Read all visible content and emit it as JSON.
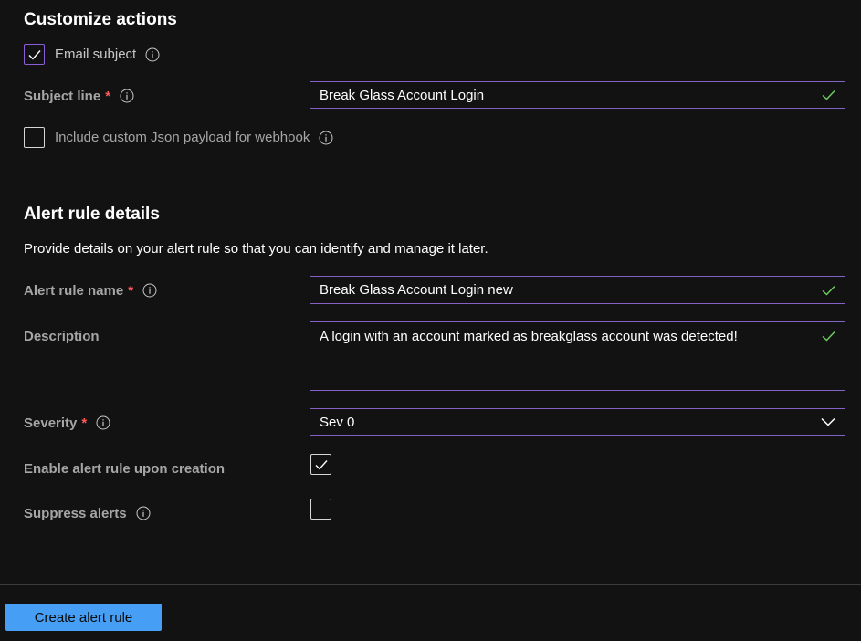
{
  "customize_actions": {
    "title": "Customize actions",
    "email_subject": {
      "label": "Email subject",
      "checked": true
    },
    "subject_line": {
      "label": "Subject line",
      "required_marker": "*",
      "value": "Break Glass Account Login"
    },
    "custom_json": {
      "label": "Include custom Json payload for webhook",
      "checked": false
    }
  },
  "alert_rule_details": {
    "title": "Alert rule details",
    "description_text": "Provide details on your alert rule so that you can identify and manage it later.",
    "alert_rule_name": {
      "label": "Alert rule name",
      "required_marker": "*",
      "value": "Break Glass Account Login new"
    },
    "description": {
      "label": "Description",
      "value": "A login with an account marked as breakglass account was detected!"
    },
    "severity": {
      "label": "Severity",
      "required_marker": "*",
      "value": "Sev 0"
    },
    "enable_rule": {
      "label": "Enable alert rule upon creation",
      "checked": true
    },
    "suppress_alerts": {
      "label": "Suppress alerts",
      "checked": false
    }
  },
  "footer": {
    "create_button_label": "Create alert rule"
  },
  "icons": {
    "info": "info-icon",
    "valid": "checkmark-icon",
    "dropdown": "chevron-down-icon"
  },
  "colors": {
    "background": "#121212",
    "accent_border": "#8661c5",
    "valid_check": "#6ccb5f",
    "required": "#ff5a5a",
    "primary_button": "#479ef5"
  }
}
